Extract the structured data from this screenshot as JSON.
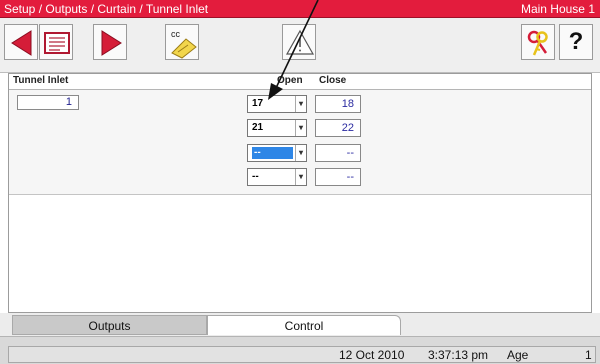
{
  "titlebar": {
    "breadcrumb": "Setup / Outputs / Curtain / Tunnel Inlet",
    "house": "Main House 1"
  },
  "toolbar": {
    "icons": [
      "arrow-left-icon",
      "list-icon",
      "arrow-right-icon",
      "cc-icon",
      "warning-icon",
      "keys-icon",
      "help-icon"
    ],
    "help_label": "?",
    "cc_label": "cc",
    "colors": {
      "arrow": "#d51d38",
      "keys": "#e8c21a"
    }
  },
  "table": {
    "headers": {
      "name": "Tunnel Inlet",
      "open": "Open",
      "close": "Close"
    },
    "id_value": "1",
    "rows": [
      {
        "open": "17",
        "close": "18"
      },
      {
        "open": "21",
        "close": "22"
      },
      {
        "open": "--",
        "close": "--",
        "selected": true
      },
      {
        "open": "--",
        "close": "--"
      }
    ]
  },
  "tabs": {
    "outputs": "Outputs",
    "control": "Control"
  },
  "status": {
    "date": "12 Oct 2010",
    "time": "3:37:13 pm",
    "age_label": "Age",
    "age_value": "1"
  }
}
